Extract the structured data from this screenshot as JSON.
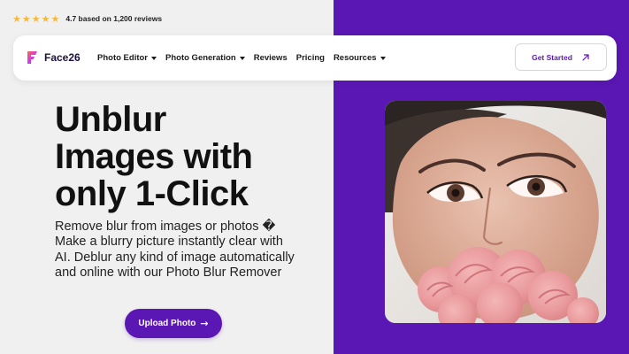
{
  "rating": {
    "stars": 5,
    "text": "4.7 based on 1,200 reviews"
  },
  "brand": {
    "name": "Face26",
    "logo_icon": "face26-logo-icon"
  },
  "nav": {
    "items": [
      {
        "label": "Photo Editor",
        "has_dropdown": true
      },
      {
        "label": "Photo Generation",
        "has_dropdown": true
      },
      {
        "label": "Reviews",
        "has_dropdown": false
      },
      {
        "label": "Pricing",
        "has_dropdown": false
      },
      {
        "label": "Resources",
        "has_dropdown": true
      }
    ],
    "cta_label": "Get Started",
    "cta_icon": "arrow-up-right-icon"
  },
  "hero": {
    "title": "Unblur\nImages with\nonly 1-Click",
    "description": "Remove blur from images or photos �\nMake a blurry picture instantly clear with\nAI. Deblur any kind of image automatically\nand online with our Photo Blur Remover",
    "button_label": "Upload Photo",
    "button_icon": "arrow-right-icon",
    "image_subject": "woman-with-pink-roses-photo"
  },
  "colors": {
    "accent": "#5a17b4",
    "star": "#f5b93a",
    "background": "#f0f0f0"
  }
}
